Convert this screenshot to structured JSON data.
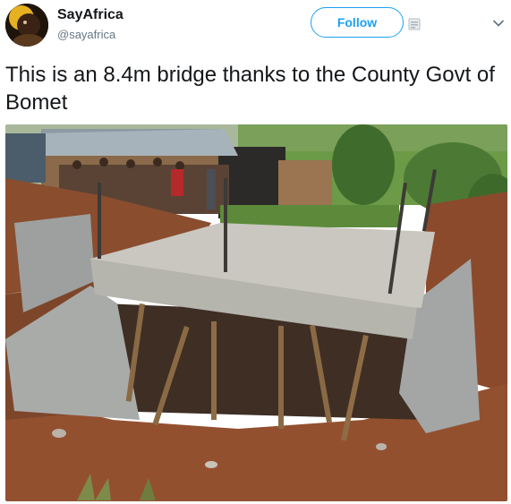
{
  "user": {
    "display_name": "SayAfrica",
    "handle": "@sayafrica"
  },
  "actions": {
    "follow_label": "Follow"
  },
  "tweet": {
    "text": "This is an 8.4m bridge thanks to the County Govt of Bomet"
  },
  "icons": {
    "extension": "extension-icon",
    "menu": "chevron-down-icon"
  },
  "colors": {
    "accent": "#1da1f2",
    "text": "#14171a",
    "muted": "#657786"
  }
}
